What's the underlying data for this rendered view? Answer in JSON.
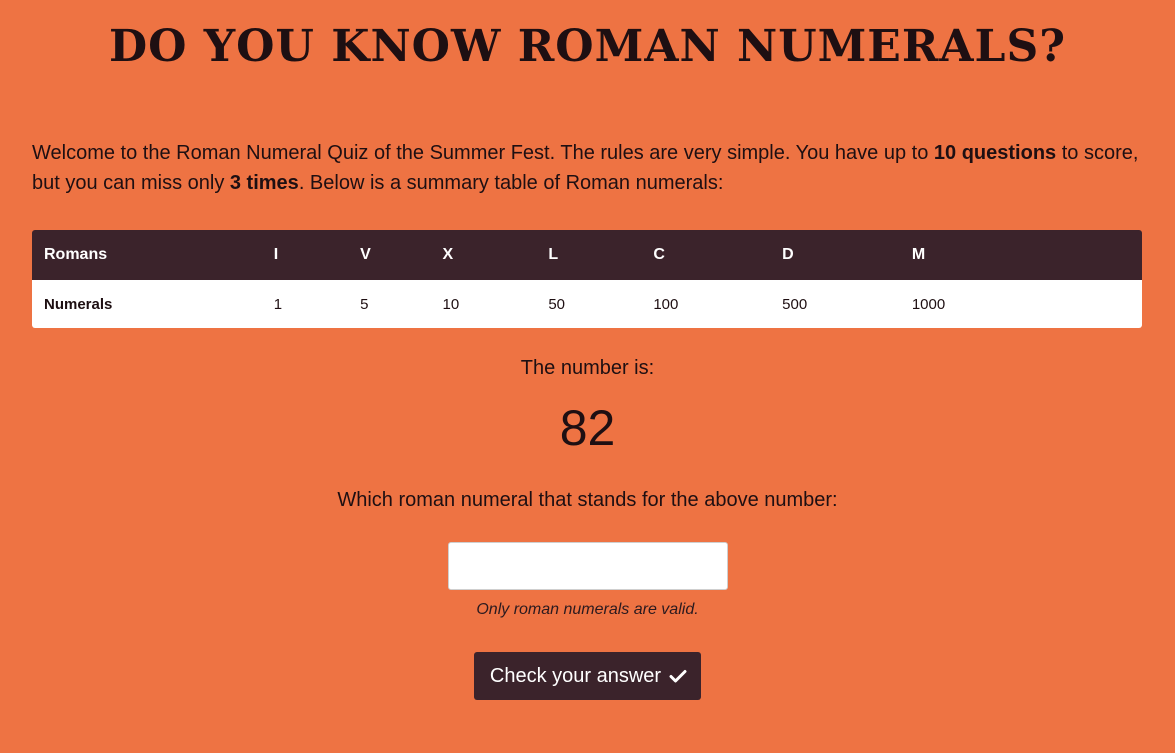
{
  "header": {
    "title": "DO YOU KNOW ROMAN NUMERALS?"
  },
  "intro": {
    "part1": "Welcome to the Roman Numeral Quiz of the Summer Fest. The rules are very simple. You have up to ",
    "bold1": "10 questions",
    "part2": " to score, but you can miss only ",
    "bold2": "3 times",
    "part3": ". Below is a summary table of Roman numerals:"
  },
  "table": {
    "header_label": "Romans",
    "row_label": "Numerals",
    "romans": [
      "I",
      "V",
      "X",
      "L",
      "C",
      "D",
      "M"
    ],
    "numerals": [
      "1",
      "5",
      "10",
      "50",
      "100",
      "500",
      "1000"
    ]
  },
  "quiz": {
    "number_label": "The number is:",
    "number_value": "82",
    "question": "Which roman numeral that stands for the above number:",
    "input_value": "",
    "input_placeholder": "",
    "hint": "Only roman numerals are valid.",
    "check_label": "Check your answer",
    "check_icon": "checkmark-icon"
  },
  "colors": {
    "background": "#ee7343",
    "dark": "#3b232b",
    "text": "#1e0f12"
  }
}
